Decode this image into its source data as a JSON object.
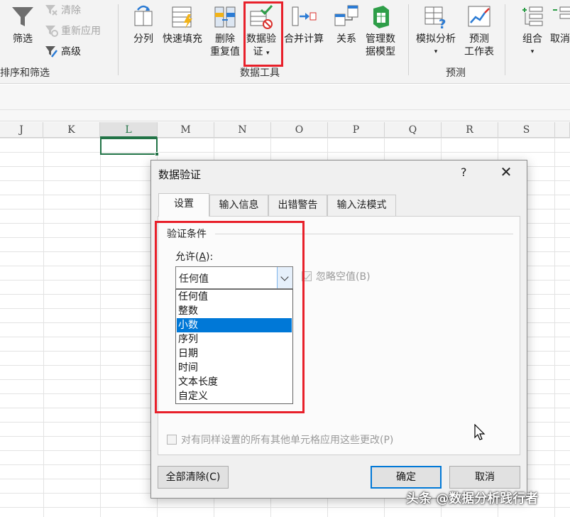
{
  "ribbon": {
    "sort_filter": {
      "filter_label": "筛选",
      "clear_label": "清除",
      "reapply_label": "重新应用",
      "advanced_label": "高级",
      "group_label": "排序和筛选"
    },
    "data_tools": {
      "split_label": "分列",
      "flash_fill_label": "快速填充",
      "remove_dup_line1": "删除",
      "remove_dup_line2": "重复值",
      "validation_line1": "数据验",
      "validation_line2": "证",
      "consolidate_label": "合并计算",
      "relations_label": "关系",
      "data_model_line1": "管理数",
      "data_model_line2": "据模型",
      "group_label": "数据工具"
    },
    "forecast": {
      "whatif_label": "模拟分析",
      "forecast_line1": "预测",
      "forecast_line2": "工作表",
      "group_label": "预测"
    },
    "outline": {
      "group_label_btn": "组合",
      "ungroup_label": "取消"
    }
  },
  "sheet": {
    "columns": [
      "J",
      "K",
      "L",
      "M",
      "N",
      "O",
      "P",
      "Q",
      "R",
      "S"
    ],
    "active_column": "L"
  },
  "dialog": {
    "title": "数据验证",
    "help": "?",
    "close": "✕",
    "tabs": [
      "设置",
      "输入信息",
      "出错警告",
      "输入法模式"
    ],
    "active_tab": "设置",
    "legend": "验证条件",
    "allow_label_prefix": "允许(",
    "allow_label_key": "A",
    "allow_label_suffix": "):",
    "allow_value": "任何值",
    "allow_options": [
      "任何值",
      "整数",
      "小数",
      "序列",
      "日期",
      "时间",
      "文本长度",
      "自定义"
    ],
    "highlighted_option": "小数",
    "ignore_blank_label": "忽略空值(B)",
    "apply_all_label": "对有同样设置的所有其他单元格应用这些更改(P)",
    "clear_all_label": "全部清除(C)",
    "ok_label": "确定",
    "cancel_label": "取消"
  },
  "watermark": "头条 @数据分析践行者",
  "colors": {
    "highlight_red": "#e8202a",
    "excel_green": "#217346",
    "selection_blue": "#0078d7"
  }
}
